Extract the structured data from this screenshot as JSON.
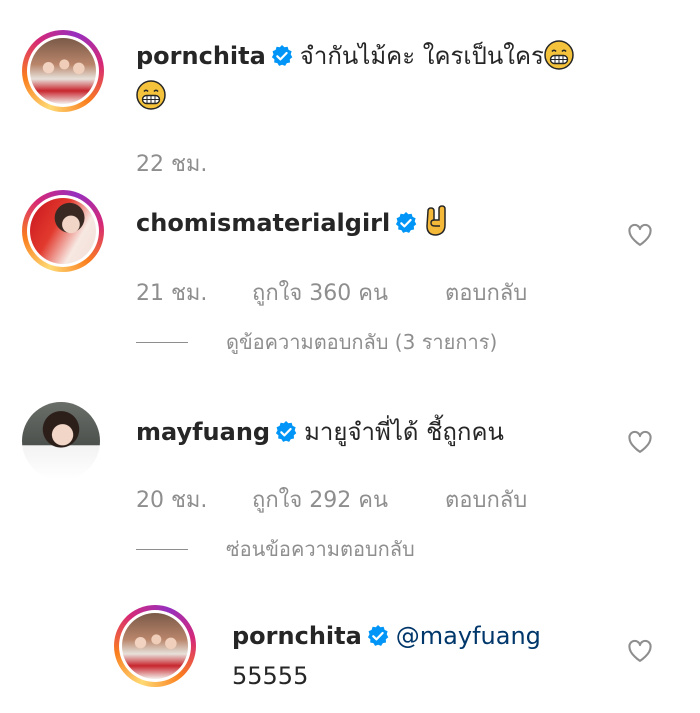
{
  "comments": [
    {
      "username": "pornchita",
      "text": "จำกันไม้คะ ใครเป็นใคร",
      "emoji": "grin-emoji",
      "time": "22 ชม."
    },
    {
      "username": "chomismaterialgirl",
      "emoji": "sign-of-horns-emoji",
      "time": "21 ชม.",
      "likes": "ถูกใจ 360 คน",
      "reply_label": "ตอบกลับ",
      "thread_label": "ดูข้อความตอบกลับ (3 รายการ)"
    },
    {
      "username": "mayfuang",
      "text": "มายูจำพี่ได้ ชี้ถูกคน",
      "time": "20 ชม.",
      "likes": "ถูกใจ 292 คน",
      "reply_label": "ตอบกลับ",
      "thread_label": "ซ่อนข้อความตอบกลับ"
    }
  ],
  "reply": {
    "username": "pornchita",
    "mention": "@mayfuang",
    "text": "55555"
  },
  "icons": {
    "verified": "verified-badge-icon",
    "like": "heart-outline-icon"
  },
  "colors": {
    "verified_blue": "#0095f6",
    "username": "#262626",
    "muted": "#8e8e8e",
    "mention": "#00376b"
  }
}
